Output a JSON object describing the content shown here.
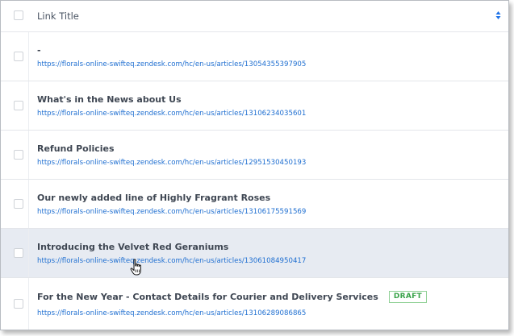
{
  "table": {
    "column_title": "Link Title",
    "rows": [
      {
        "title": "-",
        "url": "https://florals-online-swifteq.zendesk.com/hc/en-us/articles/13054355397905",
        "badge": ""
      },
      {
        "title": "What's in the News about Us",
        "url": "https://florals-online-swifteq.zendesk.com/hc/en-us/articles/13106234035601",
        "badge": ""
      },
      {
        "title": "Refund Policies",
        "url": "https://florals-online-swifteq.zendesk.com/hc/en-us/articles/12951530450193",
        "badge": ""
      },
      {
        "title": "Our newly added line of Highly Fragrant Roses",
        "url": "https://florals-online-swifteq.zendesk.com/hc/en-us/articles/13106175591569",
        "badge": ""
      },
      {
        "title": "Introducing the Velvet Red Geraniums",
        "url": "https://florals-online-swifteq.zendesk.com/hc/en-us/articles/13061084950417",
        "badge": "",
        "hovered": true
      },
      {
        "title": "For the New Year - Contact Details for Courier and Delivery Services",
        "url": "https://florals-online-swifteq.zendesk.com/hc/en-us/articles/13106289086865",
        "badge": "DRAFT"
      }
    ]
  },
  "icons": {
    "sort": "sort-arrows-icon",
    "cursor": "hand-pointer-icon"
  },
  "colors": {
    "link": "#1f6fd1",
    "draft_badge": "#3aa34a",
    "hover_row": "#e7ebf2",
    "sort_arrows": "#1f73e8"
  }
}
